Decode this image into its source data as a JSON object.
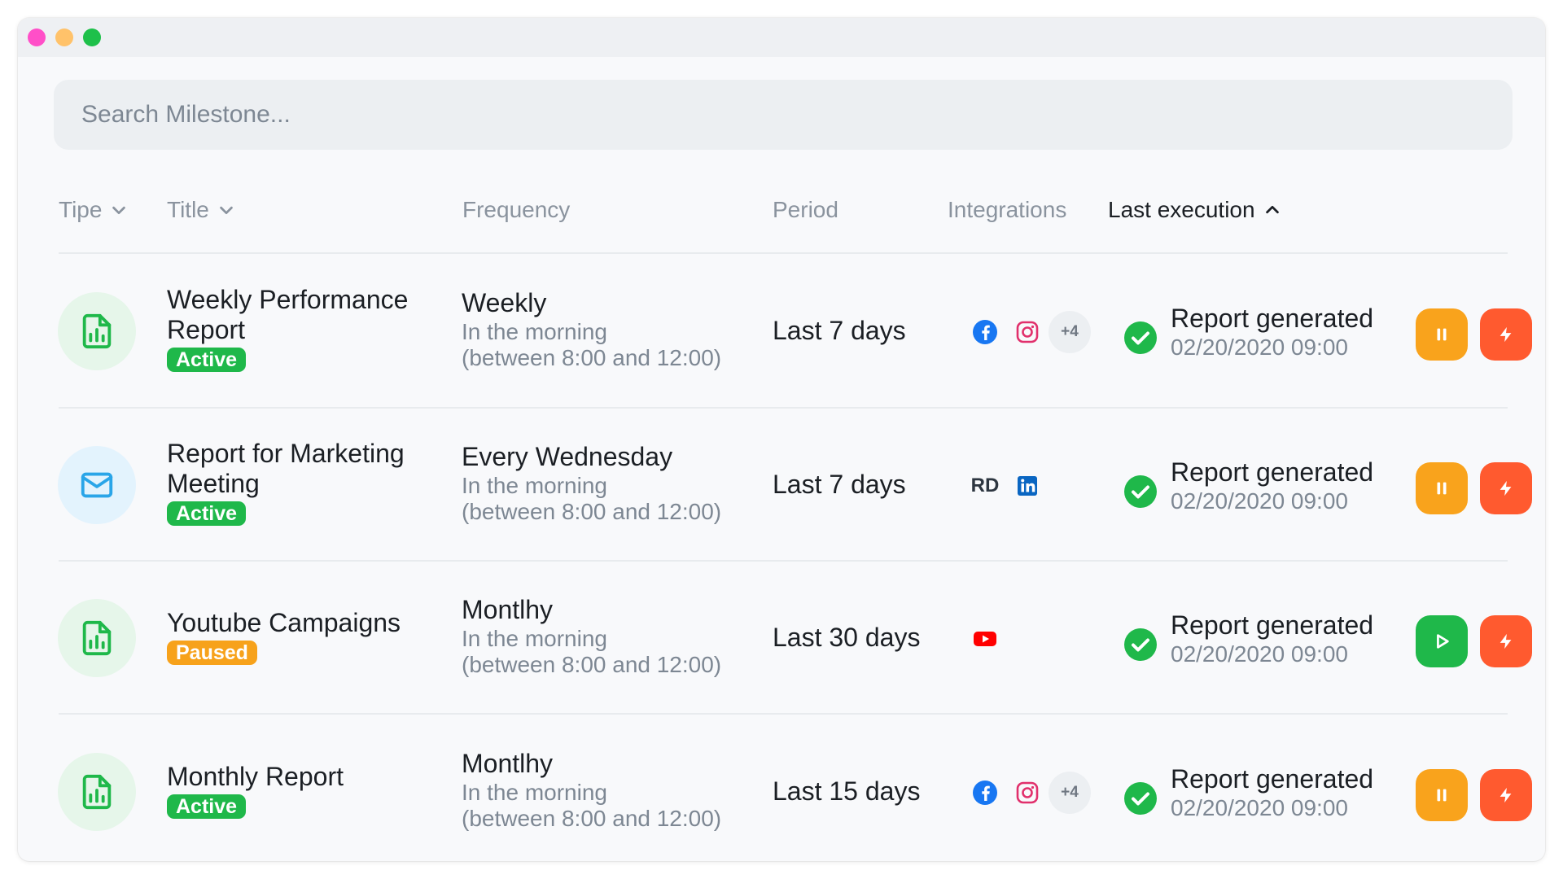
{
  "search": {
    "placeholder": "Search Milestone..."
  },
  "columns": {
    "type": "Tipe",
    "title": "Title",
    "frequency": "Frequency",
    "period": "Period",
    "integrations": "Integrations",
    "last_execution": "Last execution"
  },
  "rows": [
    {
      "type_icon": "report-chart-icon",
      "title": "Weekly Performance Report",
      "status": "Active",
      "frequency": "Weekly",
      "frequency_time": "In the morning",
      "frequency_window": "(between 8:00 and 12:00)",
      "period": "Last 7 days",
      "integrations": [
        "facebook-icon",
        "instagram-icon"
      ],
      "integrations_more": "+4",
      "last_execution": "Report generated",
      "last_execution_date": "02/20/2020 09:00",
      "toggle_action": "pause"
    },
    {
      "type_icon": "mail-icon",
      "title": "Report for Marketing Meeting",
      "status": "Active",
      "frequency": "Every Wednesday",
      "frequency_time": "In the morning",
      "frequency_window": "(between 8:00 and 12:00)",
      "period": "Last 7 days",
      "integrations": [
        "rd-station-icon",
        "linkedin-icon"
      ],
      "integrations_rd": "RD",
      "last_execution": "Report generated",
      "last_execution_date": "02/20/2020 09:00",
      "toggle_action": "pause"
    },
    {
      "type_icon": "report-chart-icon",
      "title": "Youtube Campaigns",
      "status": "Paused",
      "frequency": "Montlhy",
      "frequency_time": "In the morning",
      "frequency_window": "(between 8:00 and 12:00)",
      "period": "Last 30 days",
      "integrations": [
        "youtube-icon"
      ],
      "last_execution": "Report generated",
      "last_execution_date": "02/20/2020 09:00",
      "toggle_action": "play"
    },
    {
      "type_icon": "report-chart-icon",
      "title": "Monthly Report",
      "status": "Active",
      "frequency": "Montlhy",
      "frequency_time": "In the morning",
      "frequency_window": "(between 8:00 and 12:00)",
      "period": "Last 15 days",
      "integrations": [
        "facebook-icon",
        "instagram-icon"
      ],
      "integrations_more": "+4",
      "last_execution": "Report generated",
      "last_execution_date": "02/20/2020 09:00",
      "toggle_action": "pause"
    }
  ],
  "colors": {
    "active": "#1fb84a",
    "paused": "#f7a21b",
    "pause_button": "#f9a31c",
    "play_button": "#1fb84a",
    "run_button": "#ff5a2f"
  }
}
